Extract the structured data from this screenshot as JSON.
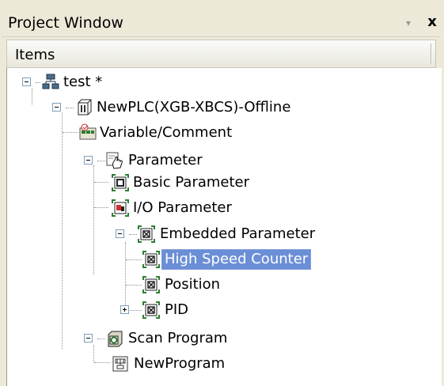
{
  "window": {
    "title": "Project Window",
    "pin_glyph": "▾",
    "close_glyph": "x"
  },
  "header": {
    "column_label": "Items"
  },
  "tree": {
    "root": {
      "label": "test *",
      "icon": "network-project-icon"
    },
    "plc": {
      "label": "NewPLC(XGB-XBCS)-Offline",
      "icon": "plc-cpu-icon"
    },
    "variable": {
      "label": "Variable/Comment",
      "icon": "variable-comment-icon"
    },
    "parameter": {
      "label": "Parameter",
      "icon": "parameter-hand-icon"
    },
    "basic_parameter": {
      "label": "Basic Parameter",
      "icon": "basic-parameter-icon"
    },
    "io_parameter": {
      "label": "I/O Parameter",
      "icon": "io-parameter-icon"
    },
    "embedded_parameter": {
      "label": "Embedded Parameter",
      "icon": "embedded-parameter-icon"
    },
    "high_speed_counter": {
      "label": "High Speed Counter",
      "icon": "high-speed-counter-icon",
      "selected": true
    },
    "position": {
      "label": "Position",
      "icon": "position-icon"
    },
    "pid": {
      "label": "PID",
      "icon": "pid-icon"
    },
    "scan_program": {
      "label": "Scan Program",
      "icon": "scan-program-icon"
    },
    "new_program": {
      "label": "NewProgram",
      "icon": "ladder-program-icon"
    }
  },
  "colors": {
    "selection_bg": "#6b8fd6",
    "window_bg": "#ece9d8"
  }
}
